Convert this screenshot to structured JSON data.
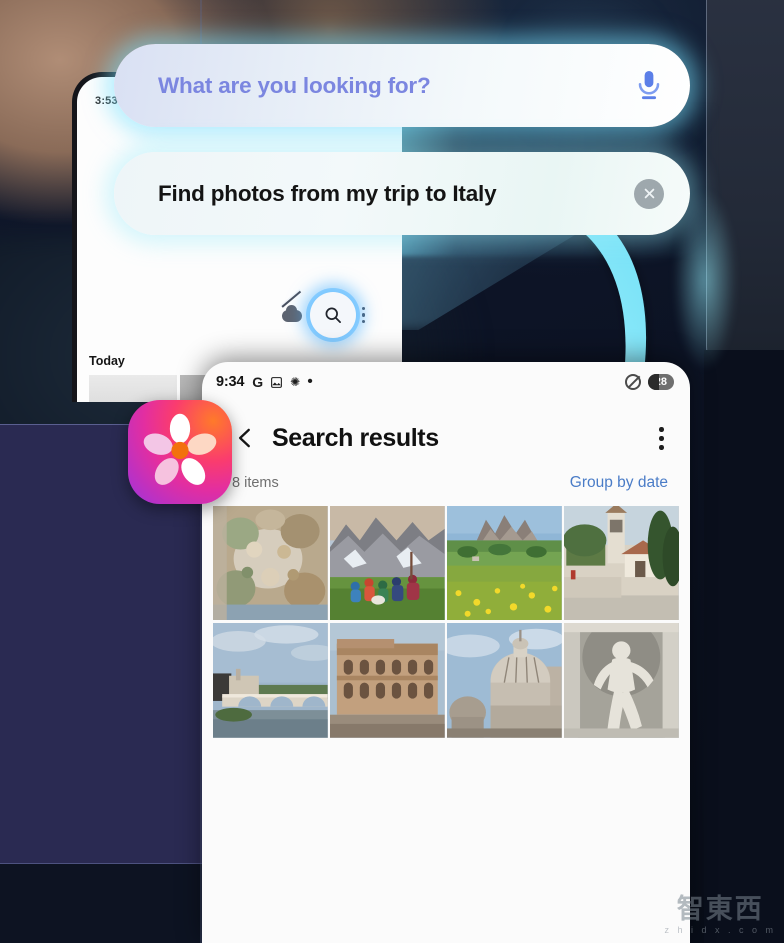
{
  "background": {
    "phone": {
      "status_time": "3:53",
      "section_label": "Today"
    },
    "controls": {
      "cloud_off_icon": "cloud-off-icon",
      "search_icon": "search-icon",
      "more_icon": "kebab-menu-icon"
    }
  },
  "voice_search": {
    "prompt": "What are you looking for?",
    "prompt_color": "#7b86e0",
    "mic_icon": "microphone-icon",
    "mic_color": "#5b7fe8",
    "query": "Find photos from my trip to Italy",
    "query_color": "#141414",
    "clear_icon": "close-circle-icon"
  },
  "arrow": {
    "name": "curved-down-arrow",
    "color_from": "#7fe6f8",
    "color_to": "#bdf0fb"
  },
  "app_icon": {
    "name": "samsung-gallery-icon",
    "gradient_from": "#ff7a2a",
    "gradient_to": "#9e33dd"
  },
  "results": {
    "status_bar": {
      "time": "9:34",
      "icons": [
        "G",
        "image-icon",
        "snowflake-icon",
        "dot-icon"
      ],
      "dnd_icon": "do-not-disturb-icon",
      "battery": "28"
    },
    "back_icon": "back-chevron-icon",
    "title": "Search results",
    "more_icon": "kebab-menu-icon",
    "item_count": "8 items",
    "group_by": "Group by date",
    "group_by_color": "#4a7cc7",
    "photos": [
      {
        "id": "photo-1",
        "alt": "Ornate painted ceiling fresco"
      },
      {
        "id": "photo-2",
        "alt": "Group of friends sitting on grass by mountains"
      },
      {
        "id": "photo-3",
        "alt": "Dolomites meadow with yellow wildflowers"
      },
      {
        "id": "photo-4",
        "alt": "Village church bell tower with cypress trees"
      },
      {
        "id": "photo-5",
        "alt": "Stone bridge over the Tiber river in Rome"
      },
      {
        "id": "photo-6",
        "alt": "The Colosseum in Rome"
      },
      {
        "id": "photo-7",
        "alt": "Dome of St. Peter's Basilica"
      },
      {
        "id": "photo-8",
        "alt": "Marble statue in a fountain niche"
      }
    ]
  },
  "watermark": {
    "cn": "智東西",
    "en": "z h i d x . c o m"
  }
}
